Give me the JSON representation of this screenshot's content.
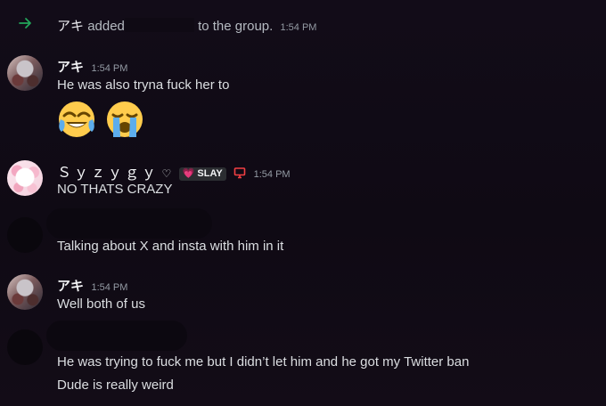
{
  "system_message": {
    "user": "アキ",
    "action": "added",
    "target_suffix": "to the group.",
    "time": "1:54 PM",
    "icon": "join-arrow-icon"
  },
  "messages": [
    {
      "author": "アキ",
      "time": "1:54 PM",
      "lines": [
        "He was also tryna fuck her to"
      ],
      "emojis": [
        "😂",
        "😭"
      ]
    },
    {
      "author": "Ｓｙｚｙｇｙ",
      "author_suffix": "♡",
      "tag_icon": "💗",
      "tag": "SLAY",
      "time": "1:54 PM",
      "device_icon": "desktop-icon",
      "device_color": "#f23f43",
      "lines": [
        "NO THATS CRAZY"
      ]
    },
    {
      "author": "",
      "lines": [
        "Talking about X and insta with him in it"
      ]
    },
    {
      "author": "アキ",
      "time": "1:54 PM",
      "lines": [
        "Well both of us"
      ]
    },
    {
      "author": "",
      "lines": [
        "He was trying to fuck me but I didn’t let him and he got my Twitter ban",
        "Dude is really weird"
      ]
    }
  ]
}
